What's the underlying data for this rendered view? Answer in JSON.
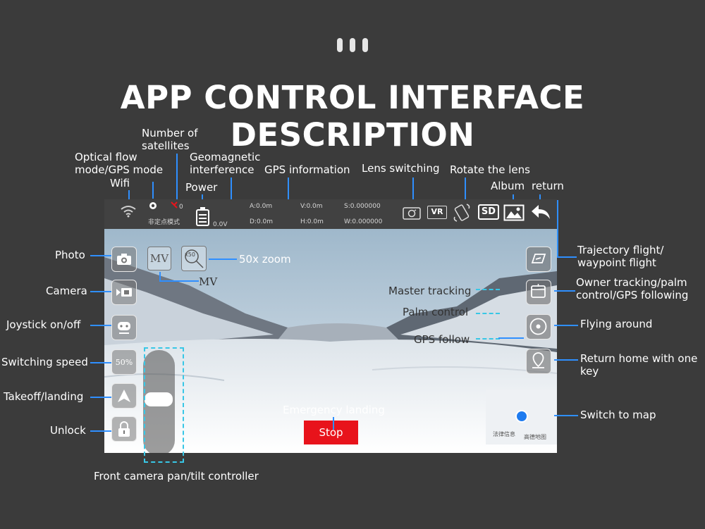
{
  "title": "APP CONTROL INTERFACE DESCRIPTION",
  "labels": {
    "satellites": "Number of satellites",
    "optical_flow": "Optical flow mode/GPS mode",
    "wifi": "Wifi",
    "geomagnetic": "Geomagnetic interference",
    "power": "Power",
    "gps_info": "GPS information",
    "lens_switching": "Lens switching",
    "rotate_lens": "Rotate the lens",
    "album": "Album",
    "return": "return",
    "photo": "Photo",
    "camera": "Camera",
    "joystick": "Joystick on/off",
    "switching_speed": "Switching speed",
    "takeoff_landing": "Takeoff/landing",
    "unlock": "Unlock",
    "zoom": "50x zoom",
    "mv": "MV",
    "master_tracking": "Master tracking",
    "palm_control": "Palm control",
    "gps_follow": "GPS follow",
    "emergency_landing": "Emergency landing",
    "trajectory": "Trajectory flight/ waypoint flight",
    "owner_tracking": "Owner tracking/palm control/GPS following",
    "flying_around": "Flying around",
    "return_home": "Return home with one key",
    "switch_map": "Switch to map",
    "pan_tilt": "Front camera pan/tilt controller"
  },
  "topbar": {
    "sat_count": "0",
    "mode_text": "非定点模式",
    "voltage": "0.0V",
    "a": "A:0.0m",
    "d": "D:0.0m",
    "v": "V:0.0m",
    "h": "H:0.0m",
    "s": "S:0.000000",
    "w": "W:0.000000",
    "vr": "VR",
    "sd": "SD"
  },
  "screen": {
    "speed": "50%",
    "mv_button": "MV",
    "zoom_button": "x50",
    "stop": "Stop",
    "map_legal": "法律信息",
    "map_brand": "高德地图"
  },
  "colors": {
    "accent_line": "#2f8fff",
    "dashed": "#38c7e6",
    "stop_red": "#e8131b",
    "map_dot": "#1e7bef"
  }
}
